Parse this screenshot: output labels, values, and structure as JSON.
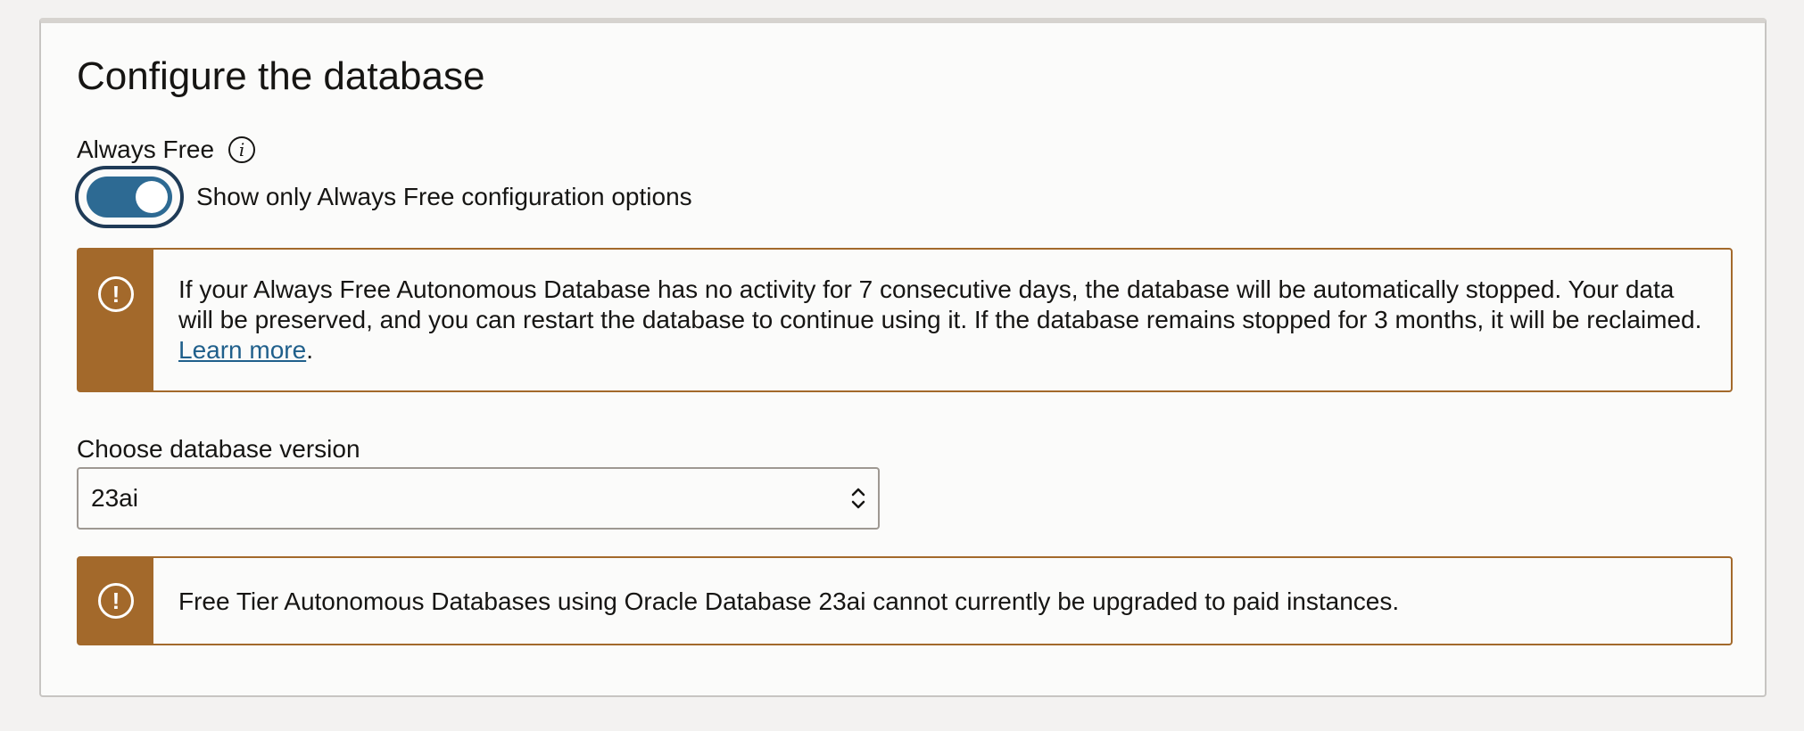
{
  "section": {
    "title": "Configure the database"
  },
  "always_free": {
    "label": "Always Free",
    "toggle_label": "Show only Always Free configuration options",
    "toggle_on": true
  },
  "alerts": [
    {
      "text_before_link": "If your Always Free Autonomous Database has no activity for 7 consecutive days, the database will be automatically stopped. Your data will be preserved, and you can restart the database to continue using it. If the database remains stopped for 3 months, it will be reclaimed.",
      "link_text": "Learn more",
      "text_after_link": "."
    },
    {
      "text": "Free Tier Autonomous Databases using Oracle Database 23ai cannot currently be upgraded to paid instances."
    }
  ],
  "database_version": {
    "label": "Choose database version",
    "selected": "23ai"
  },
  "icons": {
    "info": "info-icon",
    "warning": "warning-icon",
    "select": "chevron-up-down-icon"
  },
  "colors": {
    "toggle_on": "#2d6a93",
    "toggle_focus_ring": "#1f3b57",
    "warning_accent": "#a3692b",
    "link": "#1f5f8b",
    "panel_background": "#fbfbfa",
    "page_background": "#f3f2f1"
  },
  "glyphs": {
    "info": "i",
    "warning": "!"
  }
}
